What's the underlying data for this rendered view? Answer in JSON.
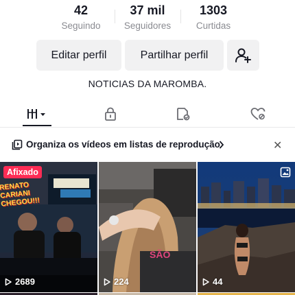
{
  "stats": [
    {
      "value": "42",
      "label": "Seguindo"
    },
    {
      "value": "37 mil",
      "label": "Seguidores"
    },
    {
      "value": "1303",
      "label": "Curtidas"
    }
  ],
  "buttons": {
    "edit_profile": "Editar perfil",
    "share_profile": "Partilhar perfil",
    "add_friend_icon": "add-user-icon"
  },
  "bio": "NOTICIAS DA MAROMBA.",
  "tabs": [
    {
      "icon": "grid-icon",
      "selected": true
    },
    {
      "icon": "lock-icon",
      "selected": false
    },
    {
      "icon": "tag-icon",
      "selected": false
    },
    {
      "icon": "liked-icon",
      "selected": false
    }
  ],
  "playlist_banner": {
    "text": "Organiza os vídeos em listas de reprodução",
    "close_icon": "close-icon"
  },
  "videos": [
    {
      "views": "2689",
      "pinned_label": "Afixado",
      "overlay_text": "RENATO CARIANI CHEGOU!!!"
    },
    {
      "views": "224",
      "overlay_text": "SÃO"
    },
    {
      "views": "44",
      "photo_badge": "photo-icon"
    }
  ],
  "colors": {
    "text": "#161823",
    "muted": "#8a8b91",
    "button_bg": "#f1f1f2",
    "accent": "#fe2c55"
  }
}
